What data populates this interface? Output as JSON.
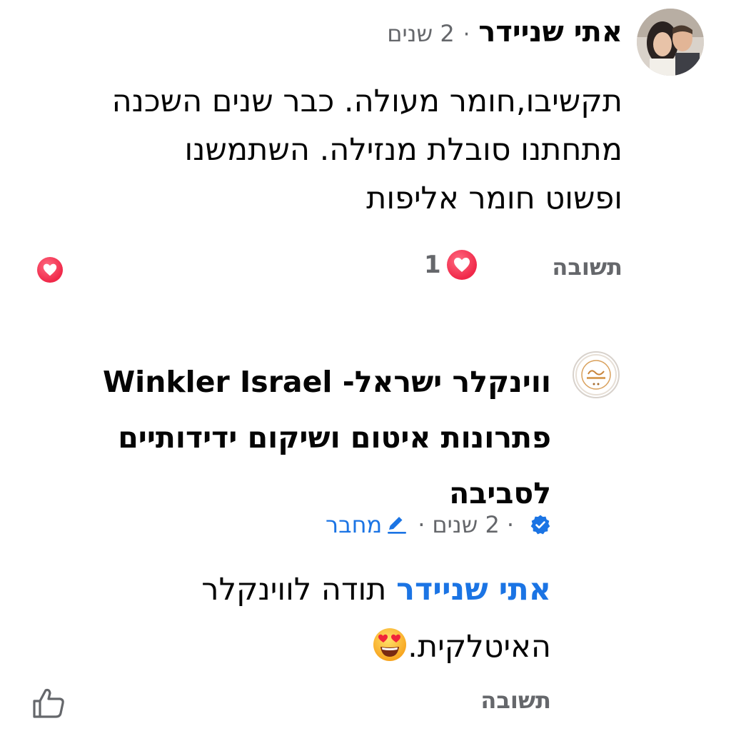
{
  "comment1": {
    "author": "אתי שניידר",
    "separator": "·",
    "time": "2 שנים",
    "body_lines": [
      "תקשיבו,חומר מעולה. כבר שנים השכנה",
      "מתחתנו סובלת מנזילה. השתמשנו",
      "ופשוט  חומר אליפות"
    ],
    "reply_label": "תשובה",
    "reaction_count": "1",
    "reaction_icon": "heart-reaction-icon",
    "avatar_icon": "profile-photo"
  },
  "comment2": {
    "author_lines": [
      "ווינקלר ישראל- Winkler Israel",
      "פתרונות איטום ושיקום ידידותיים",
      "לסביבה"
    ],
    "verified_icon": "verified-badge-icon",
    "time": "2 שנים",
    "separator": "·",
    "author_badge": "מחבר",
    "mention": "אתי שניידר",
    "body_rest": "תודה לווינקלר",
    "body_line2": "האיטלקית.",
    "emoji_icon": "heart-eyes-emoji-icon",
    "reply_label": "תשובה",
    "like_icon": "thumbs-up-icon"
  },
  "colors": {
    "text": "#050505",
    "secondary": "#65676b",
    "link": "#1b74e4",
    "heart": "#f02849"
  }
}
